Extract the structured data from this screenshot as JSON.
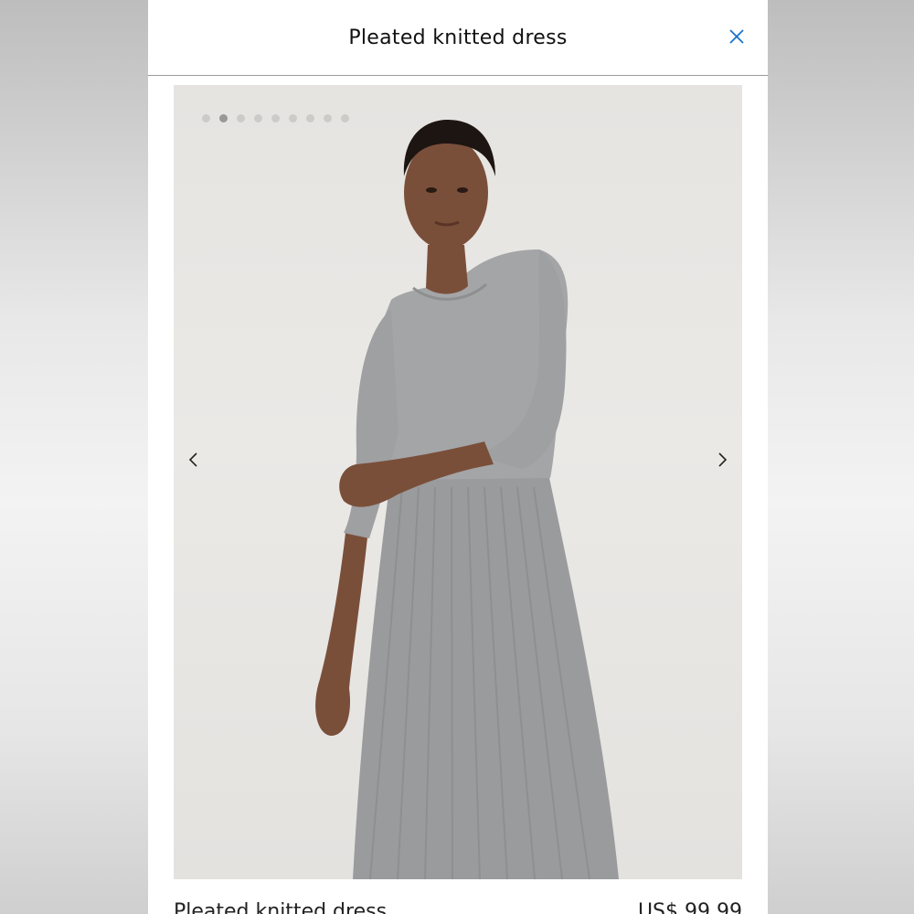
{
  "header": {
    "title": "Pleated knitted dress"
  },
  "icons": {
    "close": "close-icon",
    "prev": "chevron-left-icon",
    "next": "chevron-right-icon"
  },
  "gallery": {
    "image_count": 9,
    "active_index": 1
  },
  "product": {
    "name": "Pleated knitted dress",
    "price": "US$ 99.99"
  },
  "colors": {
    "accent": "#1a73c8",
    "dress": "#9fa0a2",
    "background": "#e8e6e3"
  }
}
